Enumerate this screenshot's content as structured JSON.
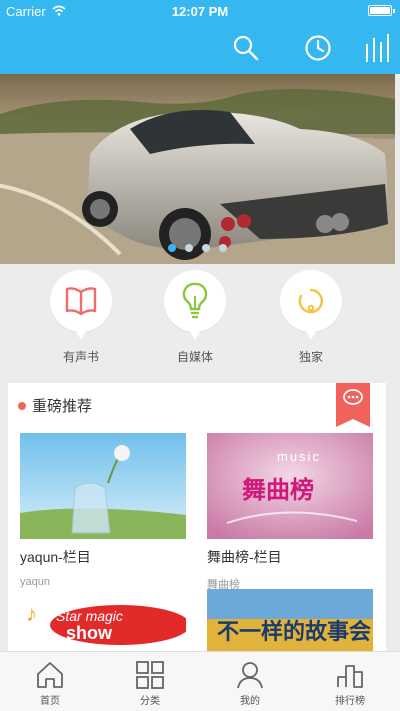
{
  "status_bar": {
    "carrier": "Carrier",
    "time": "12:07 PM"
  },
  "nav": {
    "icons": [
      "search-icon",
      "history-clock-icon",
      "ranking-bars-icon"
    ]
  },
  "banner": {
    "slides": 4,
    "active_slide": 1
  },
  "quick_links": [
    {
      "label": "有声书",
      "icon": "book-icon",
      "color": "#f26a6a"
    },
    {
      "label": "自媒体",
      "icon": "lightbulb-icon",
      "color": "#8cc63f"
    },
    {
      "label": "独家",
      "icon": "refresh-circle-icon",
      "color": "#f5c342"
    }
  ],
  "featured": {
    "title": "重磅推荐",
    "items": [
      {
        "name": "yaqun-栏目",
        "subtitle": "yaqun"
      },
      {
        "name": "舞曲榜-栏目",
        "subtitle": "舞曲榜",
        "image_text": "music 舞曲榜"
      },
      {
        "name": "",
        "subtitle": "",
        "image_text": "Star magic show"
      },
      {
        "name": "",
        "subtitle": "",
        "image_text": "不一样的故事会"
      }
    ]
  },
  "tabs": [
    {
      "label": "首页",
      "icon": "home-icon"
    },
    {
      "label": "分类",
      "icon": "grid-icon"
    },
    {
      "label": "我的",
      "icon": "user-icon"
    },
    {
      "label": "排行榜",
      "icon": "ranking-icon"
    }
  ],
  "colors": {
    "brand": "#35b7f0",
    "accent": "#f0625b"
  }
}
